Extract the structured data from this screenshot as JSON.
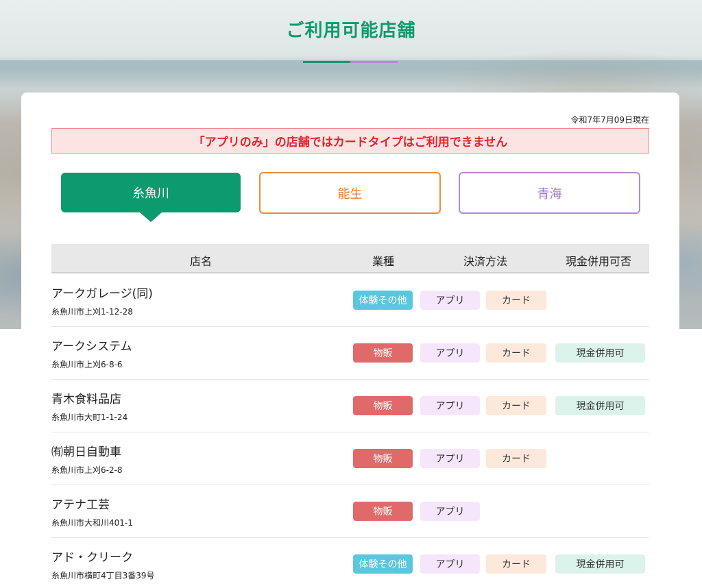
{
  "header": {
    "title": "ご利用可能店舗"
  },
  "as_of": "令和7年7月09日現在",
  "notice": "「アプリのみ」の店舗ではカードタイプはご利用できません",
  "area_tabs": [
    {
      "label": "糸魚川",
      "active": true
    },
    {
      "label": "能生",
      "active": false
    },
    {
      "label": "青海",
      "active": false
    }
  ],
  "table": {
    "headers": {
      "name": "店名",
      "type": "業種",
      "payment": "決済方法",
      "cash": "現金併用可否"
    },
    "rows": [
      {
        "name": "アークガレージ(同)",
        "address": "糸魚川市上刈1-12-28",
        "type": "体験その他",
        "type_color": "#5bc7de",
        "app": "アプリ",
        "card": "カード",
        "cash": ""
      },
      {
        "name": "アークシステム",
        "address": "糸魚川市上刈6-8-6",
        "type": "物販",
        "type_color": "#e06a6a",
        "app": "アプリ",
        "card": "カード",
        "cash": "現金併用可"
      },
      {
        "name": "青木食料品店",
        "address": "糸魚川市大町1-1-24",
        "type": "物販",
        "type_color": "#e06a6a",
        "app": "アプリ",
        "card": "カード",
        "cash": "現金併用可"
      },
      {
        "name": "㈲朝日自動車",
        "address": "糸魚川市上刈6-2-8",
        "type": "物販",
        "type_color": "#e06a6a",
        "app": "アプリ",
        "card": "カード",
        "cash": ""
      },
      {
        "name": "アテナ工芸",
        "address": "糸魚川市大和川401-1",
        "type": "物販",
        "type_color": "#e06a6a",
        "app": "アプリ",
        "card": "",
        "cash": ""
      },
      {
        "name": "アド・クリーク",
        "address": "糸魚川市横町4丁目3番39号",
        "type": "体験その他",
        "type_color": "#5bc7de",
        "app": "アプリ",
        "card": "カード",
        "cash": "現金併用可"
      }
    ]
  },
  "colors": {
    "brand_green": "#0d9a6e",
    "nou_orange": "#f07a2a",
    "oumi_purple": "#a178c2",
    "notice_red": "#e3242b"
  }
}
